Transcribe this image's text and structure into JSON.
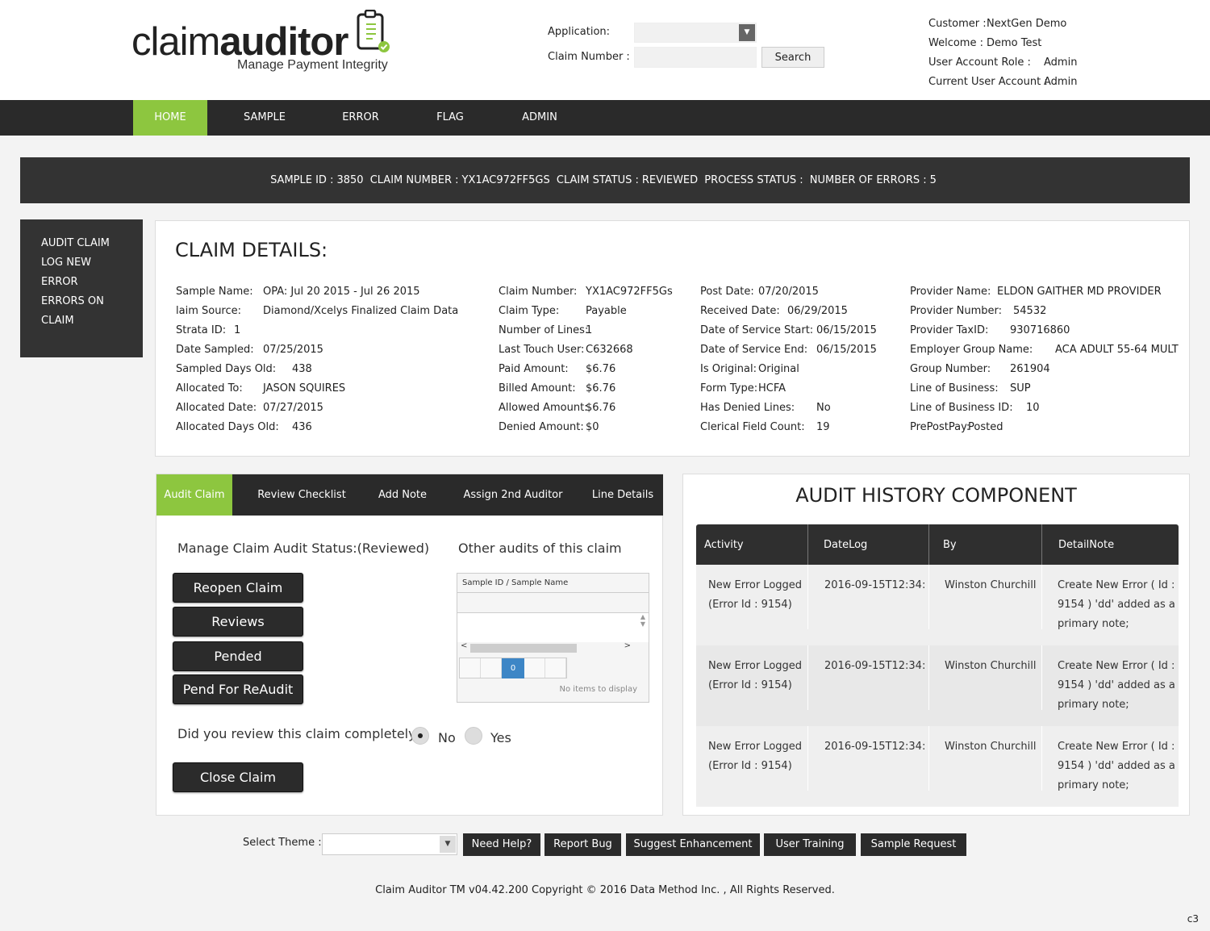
{
  "logo": {
    "word_light": "claim",
    "word_bold": "auditor",
    "tagline": "Manage Payment Integrity"
  },
  "header": {
    "application_label": "Application:",
    "application_value": "",
    "claim_number_label": "Claim Number :",
    "claim_number_value": "",
    "search_label": "Search",
    "user_info": [
      {
        "key": "Customer :",
        "value": "NextGen Demo"
      },
      {
        "key": "Welcome :",
        "value": "Demo Test"
      },
      {
        "key": "User Account Role :",
        "value": "Admin"
      },
      {
        "key": "Current User Account :",
        "value": "Admin"
      }
    ]
  },
  "nav": {
    "items": [
      "HOME",
      "SAMPLE",
      "ERROR",
      "FLAG",
      "ADMIN"
    ],
    "active": "HOME"
  },
  "sample_bar": {
    "sample_id_label": "SAMPLE ID :",
    "sample_id": "3850",
    "claim_number_label": "CLAIM NUMBER :",
    "claim_number": "YX1AC972FF5GS",
    "claim_status_label": "CLAIM STATUS :",
    "claim_status": "REVIEWED",
    "process_status_label": "PROCESS STATUS :",
    "errors_label": "NUMBER OF ERRORS :",
    "errors": "5"
  },
  "side_menu": {
    "items": [
      "AUDIT CLAIM",
      "LOG NEW",
      "ERROR",
      "ERRORS ON",
      "CLAIM"
    ]
  },
  "claim_details": {
    "title": "CLAIM DETAILS:",
    "col1": [
      {
        "k": "Sample Name:",
        "v": "OPA: Jul 20 2015 - Jul 26 2015"
      },
      {
        "k": "laim Source:",
        "v": "Diamond/Xcelys Finalized Claim Data"
      },
      {
        "k": "Strata ID:",
        "v": "1"
      },
      {
        "k": "Date Sampled:",
        "v": "07/25/2015"
      },
      {
        "k": "Sampled Days Old:",
        "v": "438"
      },
      {
        "k": "Allocated To:",
        "v": "JASON SQUIRES"
      },
      {
        "k": "Allocated Date:",
        "v": "07/27/2015"
      },
      {
        "k": "Allocated Days Old:",
        "v": "436"
      }
    ],
    "col2": [
      {
        "k": "Claim Number:",
        "v": "YX1AC972FF5Gs"
      },
      {
        "k": "Claim Type:",
        "v": "Payable"
      },
      {
        "k": "Number of Lines:",
        "v": "1"
      },
      {
        "k": "Last Touch User:",
        "v": "C632668"
      },
      {
        "k": "Paid Amount:",
        "v": "$6.76"
      },
      {
        "k": "Billed Amount:",
        "v": "$6.76"
      },
      {
        "k": "Allowed Amount:",
        "v": "$6.76"
      },
      {
        "k": "Denied Amount:",
        "v": "$0"
      }
    ],
    "col3": [
      {
        "k": "Post Date:",
        "v": "07/20/2015"
      },
      {
        "k": "Received Date:",
        "v": "06/29/2015"
      },
      {
        "k": "Date of Service Start:",
        "v": "06/15/2015"
      },
      {
        "k": "Date of Service End:",
        "v": "06/15/2015"
      },
      {
        "k": "Is Original:",
        "v": "Original"
      },
      {
        "k": "Form Type:",
        "v": "HCFA"
      },
      {
        "k": "Has Denied Lines:",
        "v": "No"
      },
      {
        "k": "Clerical Field Count:",
        "v": "19"
      }
    ],
    "col4": [
      {
        "k": "Provider Name:",
        "v": "ELDON GAITHER MD PROVIDER"
      },
      {
        "k": "Provider Number:",
        "v": "54532"
      },
      {
        "k": "Provider TaxID:",
        "v": "930716860"
      },
      {
        "k": "Employer Group Name:",
        "v": "ACA ADULT 55-64 MULT"
      },
      {
        "k": "Group Number:",
        "v": "261904"
      },
      {
        "k": "Line of Business:",
        "v": "SUP"
      },
      {
        "k": "Line of Business ID:",
        "v": "10"
      },
      {
        "k": "PrePostPay:",
        "v": "Posted"
      }
    ]
  },
  "audit": {
    "tabs": [
      "Audit Claim",
      "Review Checklist",
      "Add Note",
      "Assign 2nd Auditor",
      "Line Details"
    ],
    "active_tab": "Audit Claim",
    "manage_title": "Manage Claim Audit Status:(Reviewed)",
    "other_title": "Other audits of this claim",
    "buttons": [
      "Reopen Claim",
      "Reviews",
      "Pended",
      "Pend For ReAudit"
    ],
    "grid_header": "Sample ID / Sample Name",
    "pager_current": "0",
    "no_items": "No items to display",
    "review_question": "Did you review this claim completely",
    "radio_no": "No",
    "radio_yes": "Yes",
    "radio_selected": "No",
    "close_label": "Close Claim"
  },
  "history": {
    "title": "AUDIT HISTORY COMPONENT",
    "columns": [
      "Activity",
      "DateLog",
      "By",
      "DetailNote"
    ],
    "rows": [
      {
        "activity_1": "New Error Logged",
        "activity_2": "(Error Id : 9154)",
        "date": "2016-09-15T12:34:",
        "by": "Winston Churchill",
        "note_1": "Create New Error ( Id :",
        "note_2": "9154 ) 'dd' added as a",
        "note_3": "primary note;"
      },
      {
        "activity_1": "New Error Logged",
        "activity_2": "(Error Id : 9154)",
        "date": "2016-09-15T12:34:",
        "by": "Winston Churchill",
        "note_1": "Create New Error ( Id :",
        "note_2": "9154 ) 'dd' added as a",
        "note_3": "primary note;"
      },
      {
        "activity_1": "New Error Logged",
        "activity_2": "(Error Id : 9154)",
        "date": "2016-09-15T12:34:",
        "by": "Winston Churchill",
        "note_1": "Create New Error ( Id :",
        "note_2": "9154 ) 'dd' added as a",
        "note_3": "primary note;"
      }
    ]
  },
  "footer": {
    "theme_label": "Select Theme :",
    "theme_value": "",
    "buttons": [
      "Need Help?",
      "Report Bug",
      "Suggest Enhancement",
      "User Training",
      "Sample Request"
    ],
    "copyright": "Claim Auditor TM v04.42.200 Copyright © 2016 Data Method Inc. , All Rights Reserved.",
    "corner": "c3"
  },
  "colors": {
    "accent": "#8dc63f",
    "dark": "#2a2a2a",
    "pager": "#3d86c6"
  },
  "icons": {
    "logo_clipboard": "clipboard-check-icon",
    "dropdown": "chevron-down-icon"
  }
}
